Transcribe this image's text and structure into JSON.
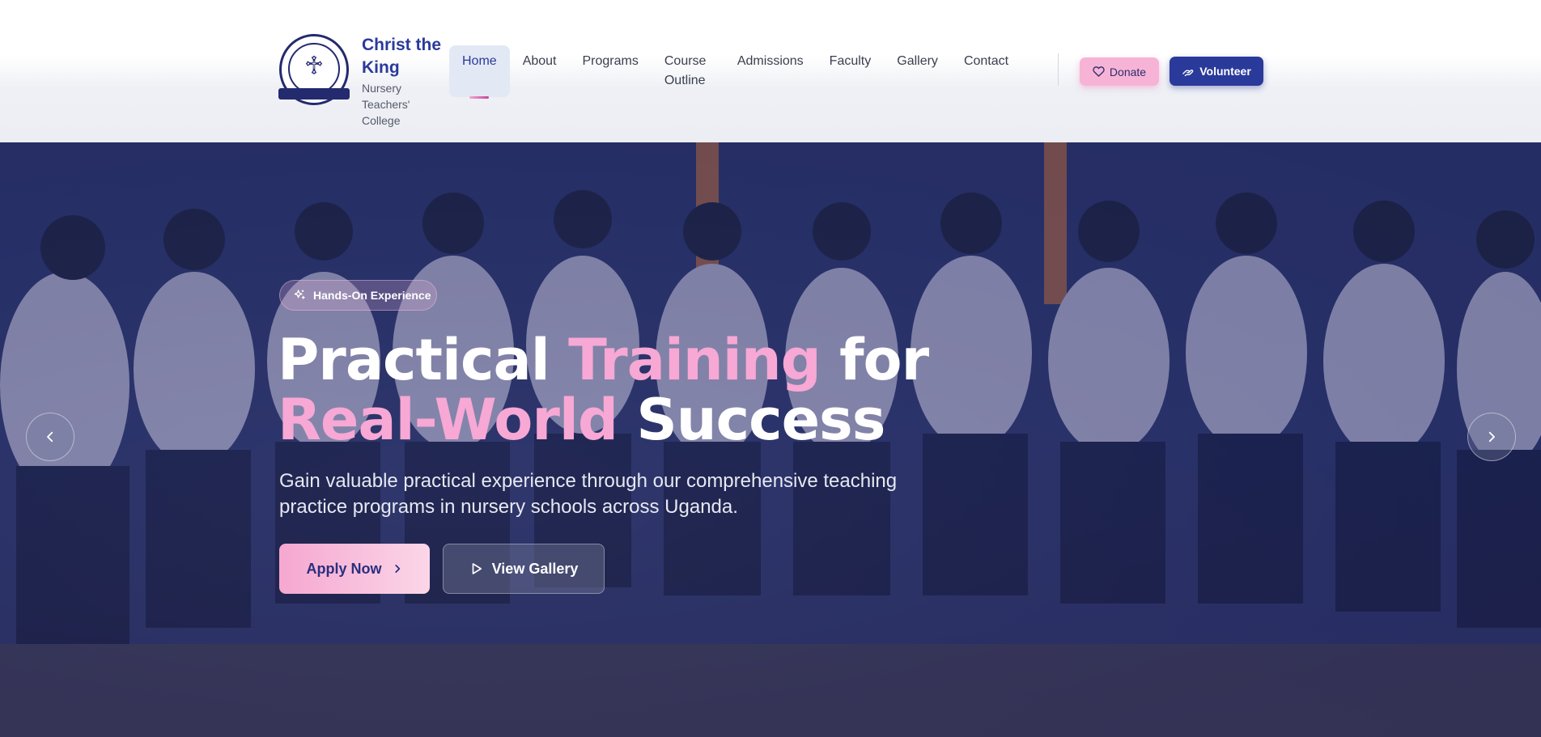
{
  "brand": {
    "name": "Christ the King",
    "subtitle": "Nursery Teachers' College",
    "logo_icon": "college-crest-icon"
  },
  "nav": {
    "items": [
      {
        "label": "Home",
        "active": true
      },
      {
        "label": "About",
        "active": false
      },
      {
        "label": "Programs",
        "active": false
      },
      {
        "label": "Course Outline",
        "active": false
      },
      {
        "label": "Admissions",
        "active": false
      },
      {
        "label": "Faculty",
        "active": false
      },
      {
        "label": "Gallery",
        "active": false
      },
      {
        "label": "Contact",
        "active": false
      }
    ]
  },
  "actions": {
    "donate_label": "Donate",
    "donate_icon": "heart-icon",
    "volunteer_label": "Volunteer",
    "volunteer_icon": "hand-icon"
  },
  "hero": {
    "badge_label": "Hands-On Experience",
    "badge_icon": "sparkles-icon",
    "headline": {
      "w1": "Practical",
      "w2": "Training",
      "w3": "for",
      "w4": "Real-World",
      "w5": "Success"
    },
    "lead": "Gain valuable practical experience through our comprehensive teaching practice programs in nursery schools across Uganda.",
    "apply_label": "Apply Now",
    "gallery_label": "View Gallery"
  },
  "colors": {
    "primary": "#2a3a9a",
    "accent_pink": "#f7a8d4",
    "hero_overlay": "#1e285f"
  }
}
